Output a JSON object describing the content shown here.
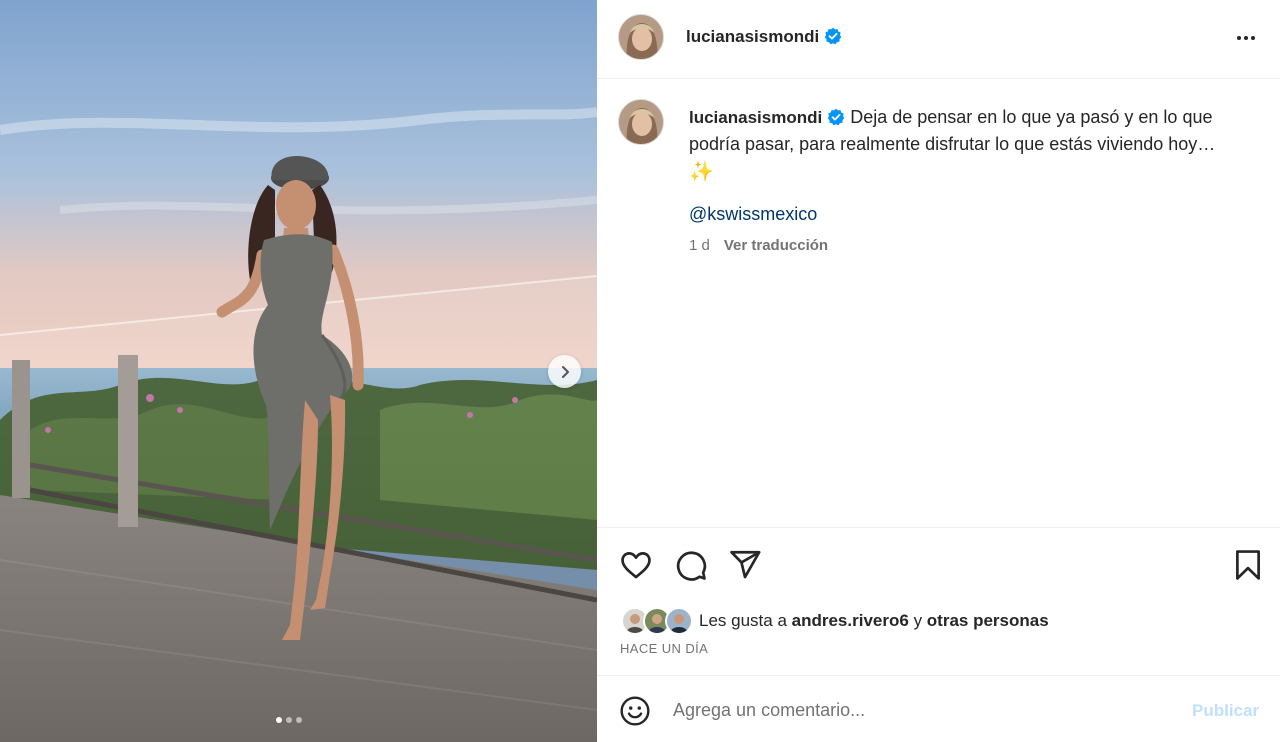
{
  "post": {
    "image_alt": "Photo of a woman in a grey dress and cap standing on a terrace by a glass railing at sunset",
    "carousel": {
      "current": 1,
      "total": 3
    }
  },
  "header": {
    "username": "lucianasismondi",
    "verified": true
  },
  "caption": {
    "username": "lucianasismondi",
    "text": "Deja de pensar en lo que ya pasó y en lo que podría pasar, para realmente disfrutar lo que estás viviendo hoy…",
    "emoji": "✨",
    "mention": "@kswissmexico",
    "time": "1 d",
    "translate_label": "Ver traducción"
  },
  "actions": {
    "like_icon": "heart-icon",
    "comment_icon": "comment-icon",
    "share_icon": "share-icon",
    "save_icon": "bookmark-icon"
  },
  "likes": {
    "prefix": "Les gusta a",
    "user": "andres.rivero6",
    "joiner": "y",
    "others": "otras personas"
  },
  "time_ago": "HACE UN DÍA",
  "comment": {
    "placeholder": "Agrega un comentario...",
    "publish_label": "Publicar"
  },
  "colors": {
    "verified": "#0095f6",
    "link": "#00376b",
    "publish_disabled": "#c0dffd",
    "secondary_text": "#737373"
  }
}
